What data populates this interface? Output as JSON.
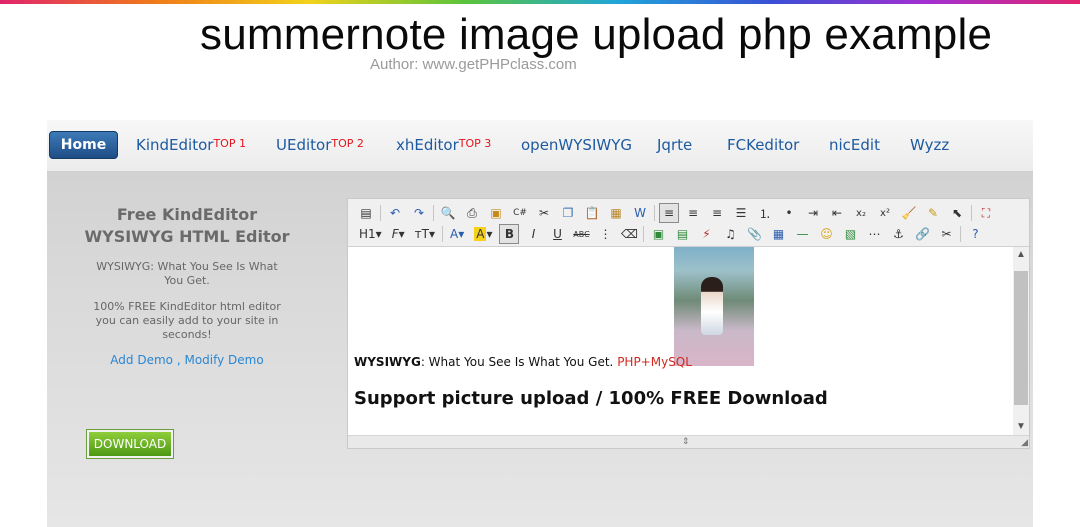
{
  "header": {
    "title": "summernote image upload php example",
    "author": "Author: www.getPHPclass.com"
  },
  "nav": {
    "home": "Home",
    "items": [
      {
        "label": "KindEditor",
        "badge": "TOP 1"
      },
      {
        "label": "UEditor",
        "badge": "TOP 2"
      },
      {
        "label": "xhEditor",
        "badge": "TOP 3"
      },
      {
        "label": "openWYSIWYG",
        "badge": ""
      },
      {
        "label": "Jqrte",
        "badge": ""
      },
      {
        "label": "FCKeditor",
        "badge": ""
      },
      {
        "label": "nicEdit",
        "badge": ""
      },
      {
        "label": "Wyzz",
        "badge": ""
      }
    ]
  },
  "sidebar": {
    "heading": "Free KindEditor WYSIWYG HTML Editor",
    "desc1": "WYSIWYG: What You See Is What You Get.",
    "desc2": "100% FREE KindEditor html editor you can easily add to your site in seconds!",
    "add_demo": "Add Demo",
    "separator": ",",
    "modify_demo": "Modify Demo",
    "download": "DOWNLOAD"
  },
  "toolbar": {
    "row1": [
      "source-icon",
      "undo-icon",
      "redo-icon",
      "preview-icon",
      "print-icon",
      "template-icon",
      "code-icon",
      "cut-icon",
      "copy-icon",
      "paste-icon",
      "paste-plain-icon",
      "paste-word-icon",
      "align-left-icon",
      "align-center-icon",
      "align-right-icon",
      "justify-icon",
      "ordered-list-icon",
      "unordered-list-icon",
      "indent-icon",
      "outdent-icon",
      "subscript-icon",
      "superscript-icon",
      "clear-format-icon",
      "select-all-icon",
      "quick-format-icon",
      "fullscreen-icon"
    ],
    "row2_labels": {
      "heading": "H1",
      "font": "F",
      "size": "тT",
      "bold": "B",
      "italic": "I",
      "underline": "U",
      "strike": "ABC"
    }
  },
  "content": {
    "line1_bold": "WYSIWYG",
    "line1_text": ": What You See Is What You Get.",
    "line1_link": "PHP+MySQL",
    "line2": "Support picture upload / 100% FREE Download"
  }
}
